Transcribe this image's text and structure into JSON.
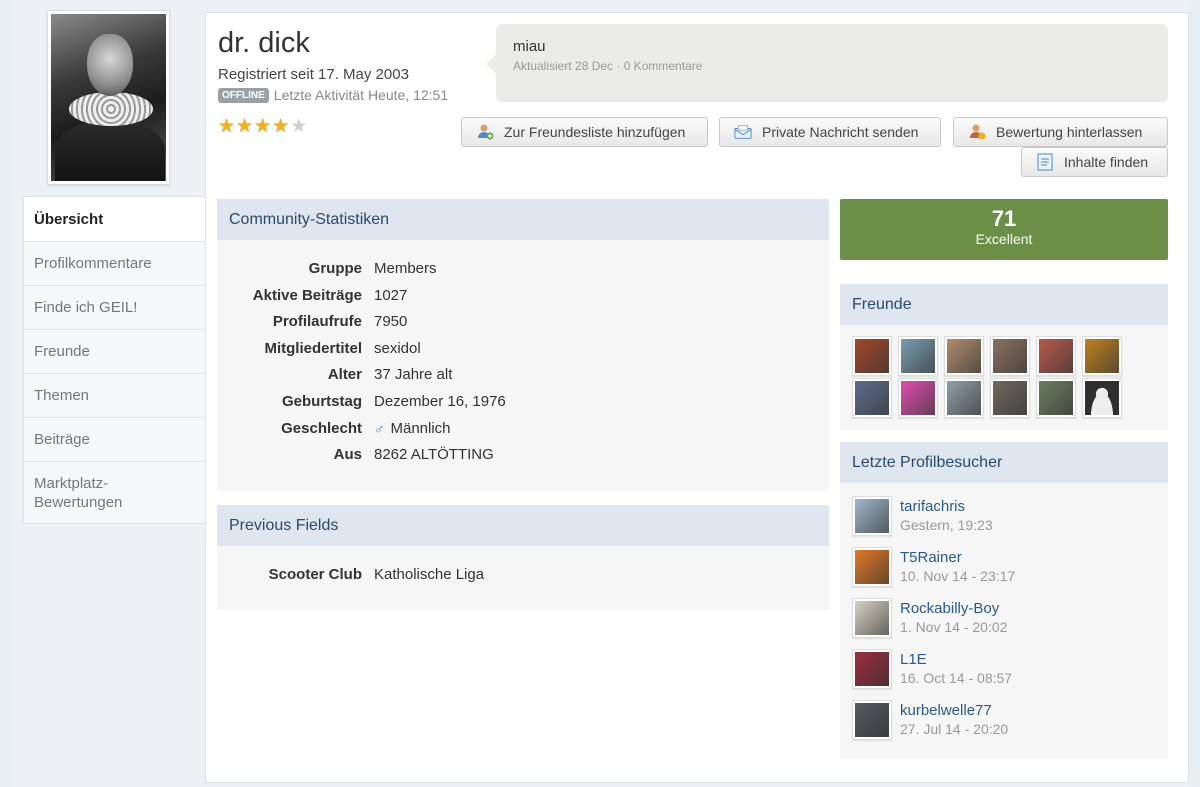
{
  "profile": {
    "name": "dr. dick",
    "registered": "Registriert seit 17. May 2003",
    "offline_badge": "OFFLINE",
    "last_activity": "Letzte Aktivität Heute, 12:51",
    "rating_stars": 4,
    "rating_max": 5
  },
  "status": {
    "text": "miau",
    "meta": "Aktualisiert 28 Dec · 0 Kommentare"
  },
  "buttons": {
    "add_friend": "Zur Freundesliste hinzufügen",
    "send_message": "Private Nachricht senden",
    "leave_rating": "Bewertung hinterlassen",
    "find_content": "Inhalte finden"
  },
  "nav": {
    "items": [
      {
        "label": "Übersicht"
      },
      {
        "label": "Profilkommentare"
      },
      {
        "label": "Finde ich GEIL!"
      },
      {
        "label": "Freunde"
      },
      {
        "label": "Themen"
      },
      {
        "label": "Beiträge"
      },
      {
        "label": "Marktplatz-Bewertungen"
      }
    ]
  },
  "community_stats": {
    "title": "Community-Statistiken",
    "rows": [
      {
        "key": "Gruppe",
        "value": "Members"
      },
      {
        "key": "Aktive Beiträge",
        "value": "1027"
      },
      {
        "key": "Profilaufrufe",
        "value": "7950"
      },
      {
        "key": "Mitgliedertitel",
        "value": "sexidol"
      },
      {
        "key": "Alter",
        "value": "37 Jahre alt"
      },
      {
        "key": "Geburtstag",
        "value": "Dezember 16, 1976"
      },
      {
        "key": "Geschlecht",
        "value": "Männlich"
      },
      {
        "key": "Aus",
        "value": "8262 ALTÖTTING"
      }
    ]
  },
  "previous_fields": {
    "title": "Previous Fields",
    "rows": [
      {
        "key": "Scooter Club",
        "value": "Katholische Liga"
      }
    ]
  },
  "reputation": {
    "value": "71",
    "label": "Excellent",
    "color": "#6b8f46"
  },
  "friends": {
    "title": "Freunde",
    "tiles": [
      "#a3472b",
      "#7a9cb0",
      "#b08d6e",
      "#8a7160",
      "#b85a4c",
      "#c08020",
      "#5c6e8c",
      "#e04fb0",
      "#8fa0a8",
      "#706860",
      "#6a7e60",
      "#777777"
    ]
  },
  "visitors": {
    "title": "Letzte Profilbesucher",
    "items": [
      {
        "name": "tarifachris",
        "time": "Gestern, 19:23"
      },
      {
        "name": "T5Rainer",
        "time": "10. Nov 14 - 23:17"
      },
      {
        "name": "Rockabilly-Boy",
        "time": "1. Nov 14 - 20:02"
      },
      {
        "name": "L1E",
        "time": "16. Oct 14 - 08:57"
      },
      {
        "name": "kurbelwelle77",
        "time": "27. Jul 14 - 20:20"
      }
    ]
  }
}
